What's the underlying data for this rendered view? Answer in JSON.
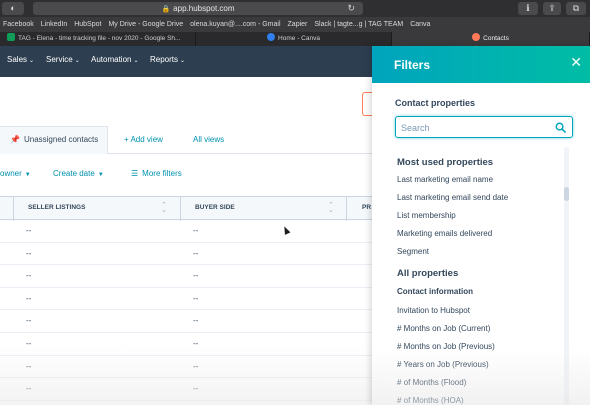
{
  "browser": {
    "url": "app.hubspot.com",
    "bookmarks": [
      "Facebook",
      "LinkedIn",
      "HubSpot",
      "My Drive - Google Drive",
      "olena.kuyan@....com - Gmail",
      "Zapier",
      "Slack | tagte...g | TAG TEAM",
      "Canva"
    ],
    "tabs": [
      {
        "label": "TAG - Elena - time tracking file - nov 2020 - Google Sh...",
        "icon": "google-sheets-icon",
        "color": "#0f9d58"
      },
      {
        "label": "Home - Canva",
        "icon": "canva-icon",
        "color": "#2f7ff0"
      },
      {
        "label": "Contacts",
        "icon": "hubspot-icon",
        "color": "#ff7a59"
      }
    ]
  },
  "nav": {
    "items": [
      "Sales",
      "Service",
      "Automation",
      "Reports"
    ]
  },
  "views": {
    "active": "Unassigned contacts",
    "add_view": "+ Add view",
    "all_views": "All views"
  },
  "filters_bar": {
    "owner": "owner",
    "create_date": "Create date",
    "more_filters": "More filters"
  },
  "table": {
    "columns": [
      "SELLER LISTINGS",
      "BUYER SIDE",
      "PR"
    ],
    "rows": [
      [
        "--",
        "--"
      ],
      [
        "--",
        "--"
      ],
      [
        "--",
        "--"
      ],
      [
        "--",
        "--"
      ],
      [
        "--",
        "--"
      ],
      [
        "--",
        "--"
      ],
      [
        "--",
        "--"
      ],
      [
        "--",
        "--"
      ]
    ]
  },
  "panel": {
    "title": "Filters",
    "contact_properties": "Contact properties",
    "search_placeholder": "Search",
    "most_used_heading": "Most used properties",
    "most_used": [
      "Last marketing email name",
      "Last marketing email send date",
      "List membership",
      "Marketing emails delivered",
      "Segment"
    ],
    "all_heading": "All properties",
    "contact_info_heading": "Contact information",
    "all_items": [
      "Invitation to Hubspot",
      "# Months on Job (Current)",
      "# Months on Job (Previous)",
      "# Years on Job (Previous)",
      "# of Months (Flood)",
      "# of Months (HOA)"
    ]
  },
  "colors": {
    "nav_bg": "#2d3e50",
    "panel_header_start": "#00a4bd",
    "panel_header_end": "#00bda5",
    "link": "#0091ae",
    "accent_orange": "#ff7a59"
  }
}
